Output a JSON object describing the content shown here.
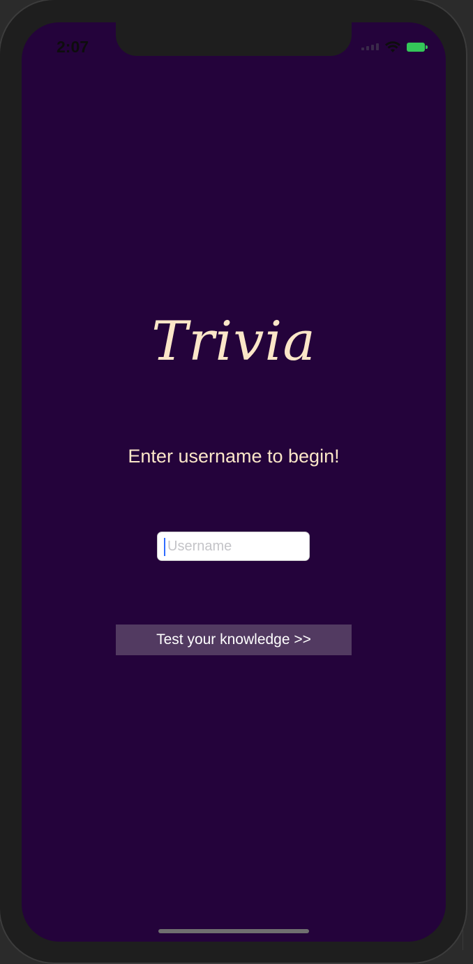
{
  "status_bar": {
    "time": "2:07"
  },
  "app": {
    "title": "Trivia",
    "prompt": "Enter username to begin!",
    "username_placeholder": "Username",
    "start_button_label": "Test your knowledge >>"
  },
  "colors": {
    "background": "#24033b",
    "accent_text": "#fbe6c8",
    "button_background": "#523a61",
    "battery": "#34c759"
  }
}
